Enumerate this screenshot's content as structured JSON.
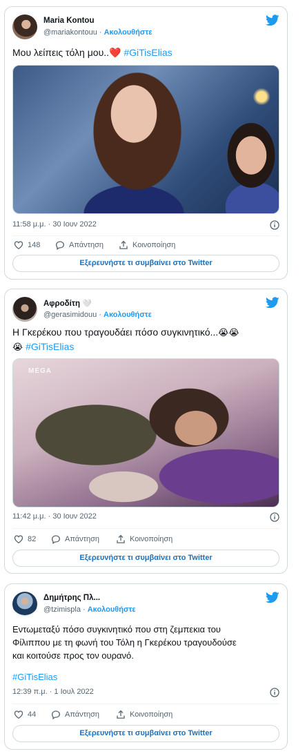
{
  "tweets": [
    {
      "name": "Maria Kontou",
      "handle": "@mariakontouu",
      "follow": "Ακολουθήστε",
      "text_before": "Μου λείπεις τόλη μου..",
      "text_after": "",
      "hashtag": "#GiTisElias",
      "time": "11:58 μ.μ. · 30 Ιουν 2022",
      "likes": "148",
      "reply_label": "Απάντηση",
      "share_label": "Κοινοποίηση",
      "explore_label": "Εξερευνήστε τι συμβαίνει στο Twitter"
    },
    {
      "name": "Αφροδίτη",
      "handle": "@gerasimidouu",
      "follow": "Ακολουθήστε",
      "text_before": "Η Γκερέκου που τραγουδάει πόσο συγκινητικό...",
      "hashtag": "#GiTisElias",
      "media_logo": "MEGA",
      "time": "11:42 μ.μ. · 30 Ιουν 2022",
      "likes": "82",
      "reply_label": "Απάντηση",
      "share_label": "Κοινοποίηση",
      "explore_label": "Εξερευνήστε τι συμβαίνει στο Twitter"
    },
    {
      "name": "Δημήτρης Πλ...",
      "handle": "@tzimispla",
      "follow": "Ακολουθήστε",
      "text_lines": [
        "Εντωμεταξύ πόσο συγκινητικό που στη ζεμπεκια του",
        "Φίλιππου με τη φωνή του Τόλη η Γκερέκου τραγουδούσε",
        "και κοιτούσε προς τον ουρανό."
      ],
      "hashtag": "#GiTisElias",
      "time": "12:39 π.μ. · 1 Ιουλ 2022",
      "likes": "44",
      "reply_label": "Απάντηση",
      "share_label": "Κοινοποίηση",
      "explore_label": "Εξερευνήστε τι συμβαίνει στο Twitter"
    }
  ],
  "colors": {
    "accent": "#1d9bf0",
    "border": "#cfd9de",
    "secondary_text": "#536471",
    "heart": "#e0245e"
  },
  "icons": [
    "twitter-bird-icon",
    "info-icon",
    "like-heart-icon",
    "reply-bubble-icon",
    "share-icon",
    "red-heart-emoji",
    "crying-face-emoji",
    "white-heart-emoji"
  ]
}
